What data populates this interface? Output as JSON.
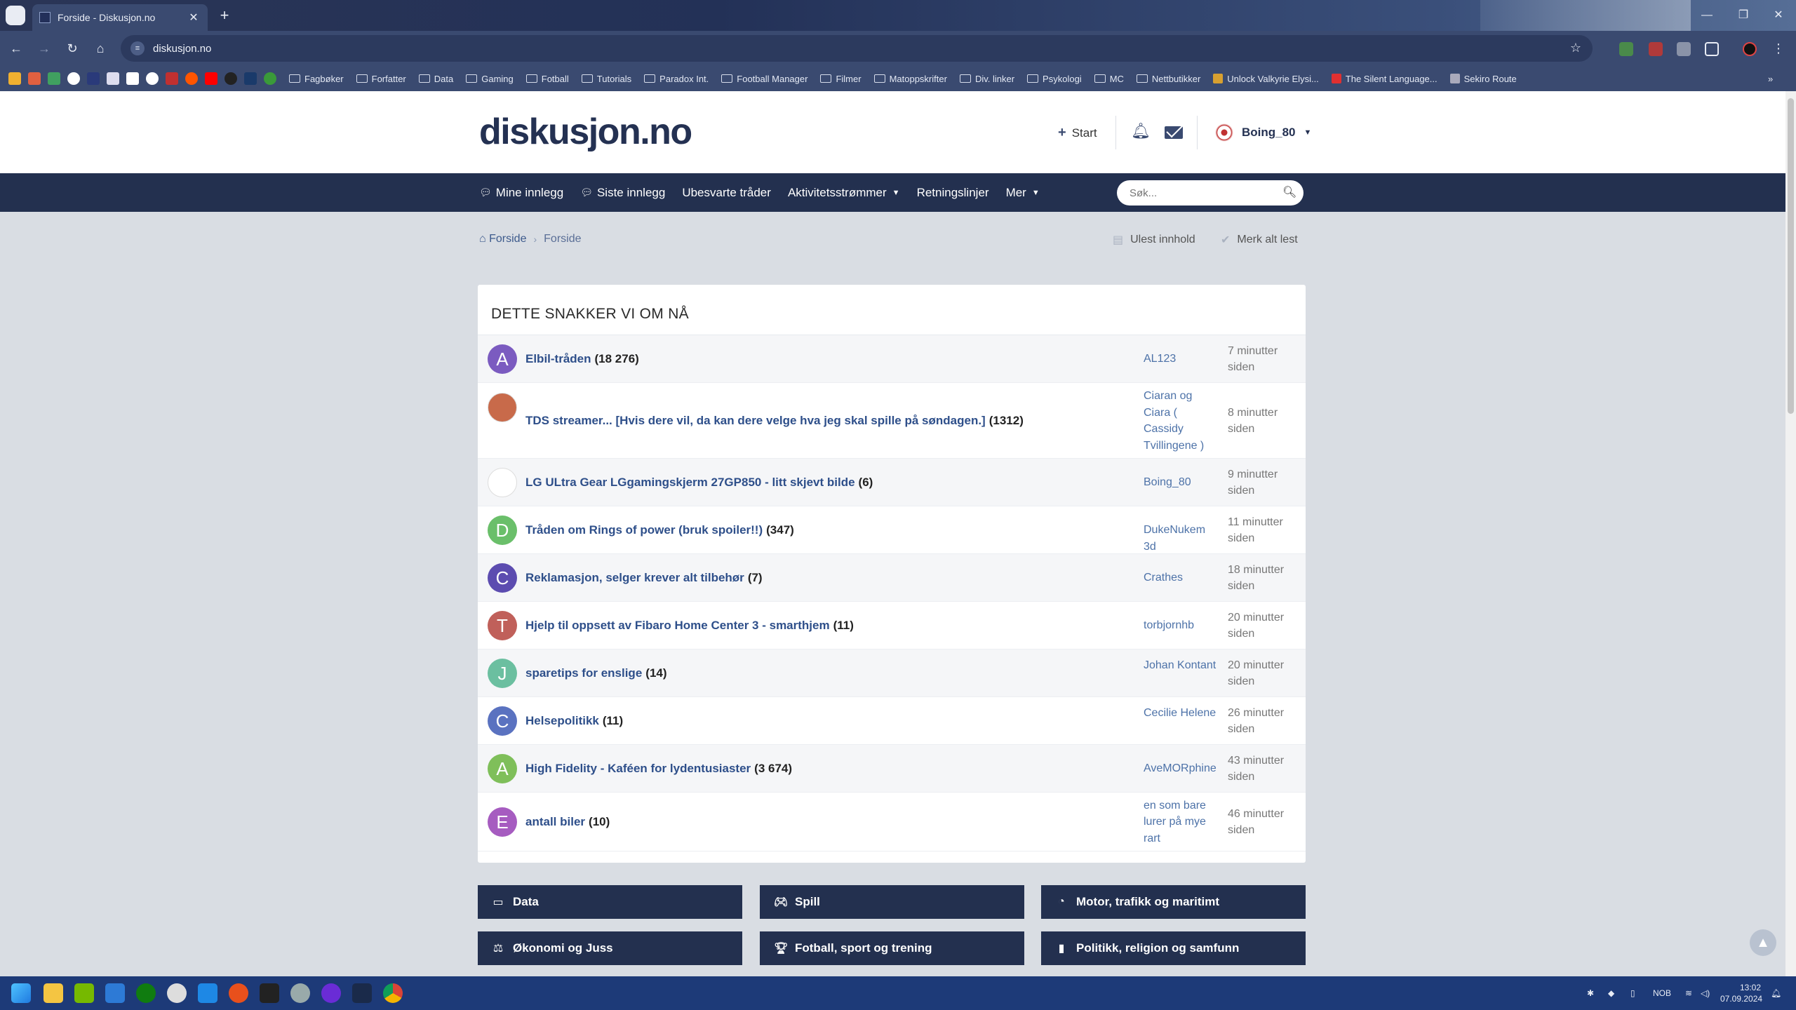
{
  "browser": {
    "tab_title": "Forside - Diskusjon.no",
    "tab_close": "✕",
    "new_tab": "+",
    "url": "diskusjon.no",
    "bookmarks": [
      "Fagbøker",
      "Forfatter",
      "Data",
      "Gaming",
      "Fotball",
      "Tutorials",
      "Paradox Int.",
      "Football Manager",
      "Filmer",
      "Matoppskrifter",
      "Div. linker",
      "Psykologi",
      "MC",
      "Nettbutikker",
      "Unlock Valkyrie Elysi...",
      "The Silent Language...",
      "Sekiro Route"
    ],
    "bookmarks_overflow": "»",
    "window_controls": [
      "—",
      "❐",
      "✕"
    ]
  },
  "site": {
    "logo": "diskusjon.no",
    "start_label": "Start",
    "username": "Boing_80",
    "nav": {
      "my_posts": "Mine innlegg",
      "latest_posts": "Siste innlegg",
      "unanswered": "Ubesvarte tråder",
      "activity": "Aktivitetsstrømmer",
      "guidelines": "Retningslinjer",
      "more": "Mer"
    },
    "search_placeholder": "Søk...",
    "breadcrumb": {
      "home": "Forside",
      "current": "Forside"
    },
    "unread_label": "Ulest innhold",
    "mark_read_label": "Merk alt lest"
  },
  "panel": {
    "title": "DETTE SNAKKER VI OM NÅ",
    "rows": [
      {
        "initial": "A",
        "color": "#7b5bc0",
        "topic": "Elbil-tråden",
        "count": "(18 276)",
        "author": "AL123",
        "time": "7 minutter siden"
      },
      {
        "initial": "",
        "color": "#c86a4a",
        "topic": "TDS streamer... [Hvis dere vil, da kan dere velge hva jeg skal spille på søndagen.]",
        "count": "(1312)",
        "author": "Ciaran og Ciara ( Cassidy Tvillingene )",
        "time": "8 minutter siden"
      },
      {
        "initial": "",
        "color": "#ffffff",
        "topic": "LG ULtra Gear LGgamingskjerm 27GP850 - litt skjevt bilde",
        "count": "(6)",
        "author": "Boing_80",
        "time": "9 minutter siden"
      },
      {
        "initial": "D",
        "color": "#6abf6a",
        "topic": "Tråden om Rings of power (bruk spoiler!!)",
        "count": "(347)",
        "author": "DukeNukem 3d",
        "time": "11 minutter siden"
      },
      {
        "initial": "C",
        "color": "#5c4cb0",
        "topic": "Reklamasjon, selger krever alt tilbehør",
        "count": "(7)",
        "author": "Crathes",
        "time": "18 minutter siden"
      },
      {
        "initial": "T",
        "color": "#c0605a",
        "topic": "Hjelp til oppsett av Fibaro Home Center 3 - smarthjem",
        "count": "(11)",
        "author": "torbjornhb",
        "time": "20 minutter siden"
      },
      {
        "initial": "J",
        "color": "#6bbfa0",
        "topic": "sparetips for enslige",
        "count": "(14)",
        "author": "Johan Kontant",
        "time": "20 minutter siden"
      },
      {
        "initial": "C",
        "color": "#5a72c0",
        "topic": "Helsepolitikk",
        "count": "(11)",
        "author": "Cecilie Helene",
        "time": "26 minutter siden"
      },
      {
        "initial": "A",
        "color": "#7fbf5a",
        "topic": "High Fidelity - Kaféen for lydentusiaster",
        "count": "(3 674)",
        "author": "AveMORphine",
        "time": "43 minutter siden"
      },
      {
        "initial": "E",
        "color": "#a65cc0",
        "topic": "antall biler",
        "count": "(10)",
        "author": "en som bare lurer på mye rart",
        "time": "46 minutter siden"
      }
    ]
  },
  "categories": [
    "Data",
    "Spill",
    "Motor, trafikk og maritimt",
    "Økonomi og Juss",
    "Fotball, sport og trening",
    "Politikk, religion og samfunn"
  ],
  "taskbar": {
    "language": "NOB",
    "time": "13:02",
    "date": "07.09.2024"
  }
}
